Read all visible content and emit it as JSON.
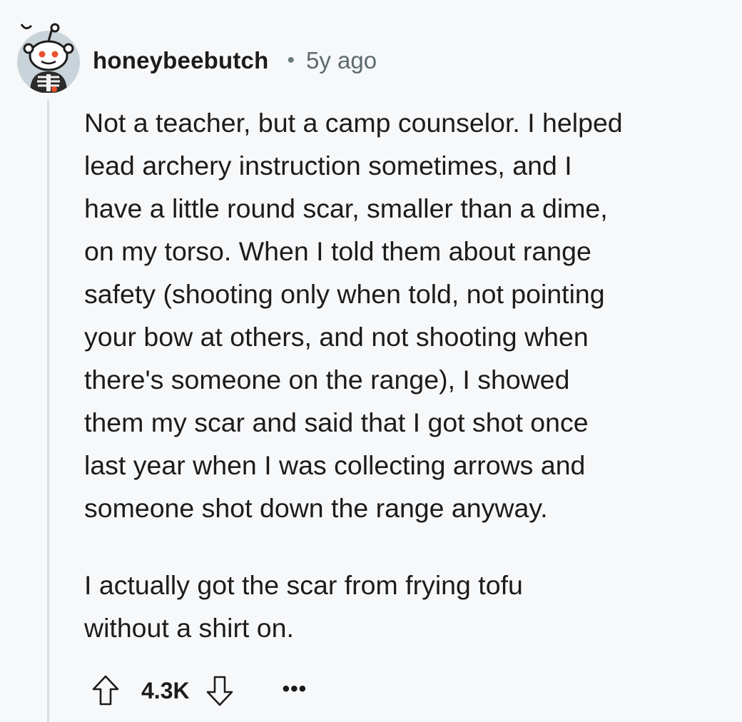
{
  "comment": {
    "author": "honeybeebutch",
    "separator": "•",
    "age": "5y ago",
    "paragraphs": [
      "Not a teacher, but a camp counselor. I helped\nlead archery instruction sometimes, and I\nhave a little round scar, smaller than a dime,\non my torso. When I told them about range\nsafety (shooting only when told, not pointing\nyour bow at others, and not shooting when\nthere's someone on the range), I showed\nthem my scar and said that I got shot once\nlast year when I was collecting arrows and\nsomeone shot down the range anyway.",
      "I actually got the scar from frying tofu\nwithout a shirt on."
    ],
    "score": "4.3K",
    "more_label": "•••"
  },
  "icons": {
    "avatar": "reddit-snoo-avatar",
    "upvote": "arrow-up-outline",
    "downvote": "arrow-down-outline",
    "more": "ellipsis"
  },
  "colors": {
    "background": "#f7f8fa",
    "text": "#1c1c1c",
    "meta": "#5d6a70",
    "thread_line": "#d7dee2",
    "avatar_eye": "#e8512d"
  }
}
